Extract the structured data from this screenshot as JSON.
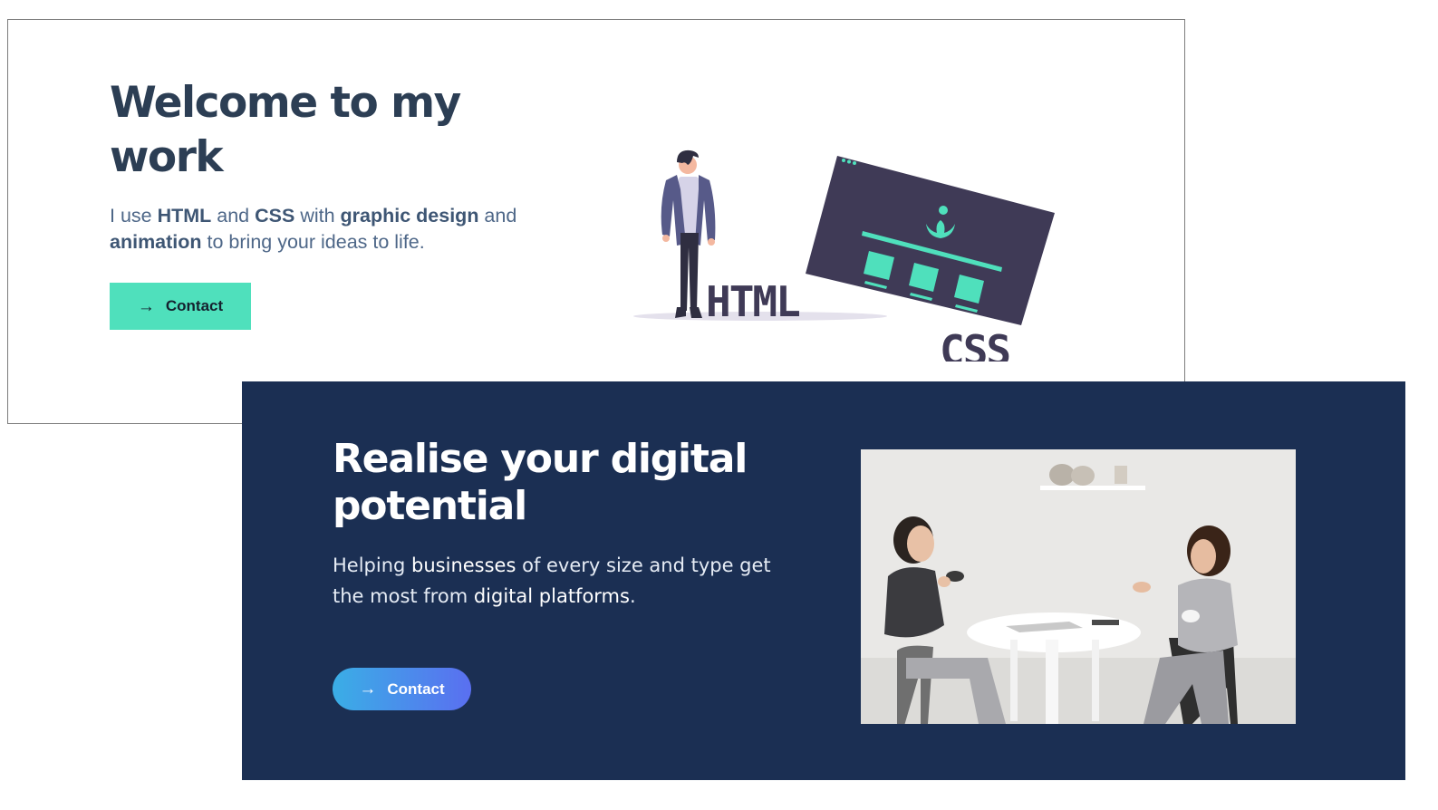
{
  "card1": {
    "title": "Welcome to my work",
    "desc": {
      "t1": "I use ",
      "b1": "HTML",
      "t2": " and ",
      "b2": "CSS",
      "t3": " with ",
      "b3": "graphic design",
      "t4": " and ",
      "b4": "animation",
      "t5": " to bring your ideas to life."
    },
    "button_label": "Contact",
    "button_icon": "arrow-right-icon",
    "illustration_text": {
      "html": "HTML",
      "css": "CSS"
    },
    "colors": {
      "accent": "#4fe0bc",
      "heading": "#2c3e54",
      "body": "#4e6788"
    }
  },
  "card2": {
    "title": "Realise your digital potential",
    "desc": {
      "t1": "Helping ",
      "h1": "businesses",
      "t2": " of every size and type get the most from ",
      "h2": "digital platforms",
      "t3": "."
    },
    "button_label": "Contact",
    "button_icon": "arrow-right-icon",
    "colors": {
      "background": "#1b2f53",
      "button_start": "#3aaee6",
      "button_end": "#5a6ff0"
    }
  }
}
